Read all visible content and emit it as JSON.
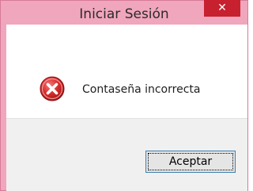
{
  "window": {
    "title": "Iniciar Sesión",
    "close_symbol": "✕",
    "title_color": "#f0a6bc",
    "close_color": "#c7202e"
  },
  "message": {
    "icon": "error-icon",
    "text": "Contaseña incorrecta"
  },
  "buttons": {
    "accept_label": "Aceptar"
  }
}
